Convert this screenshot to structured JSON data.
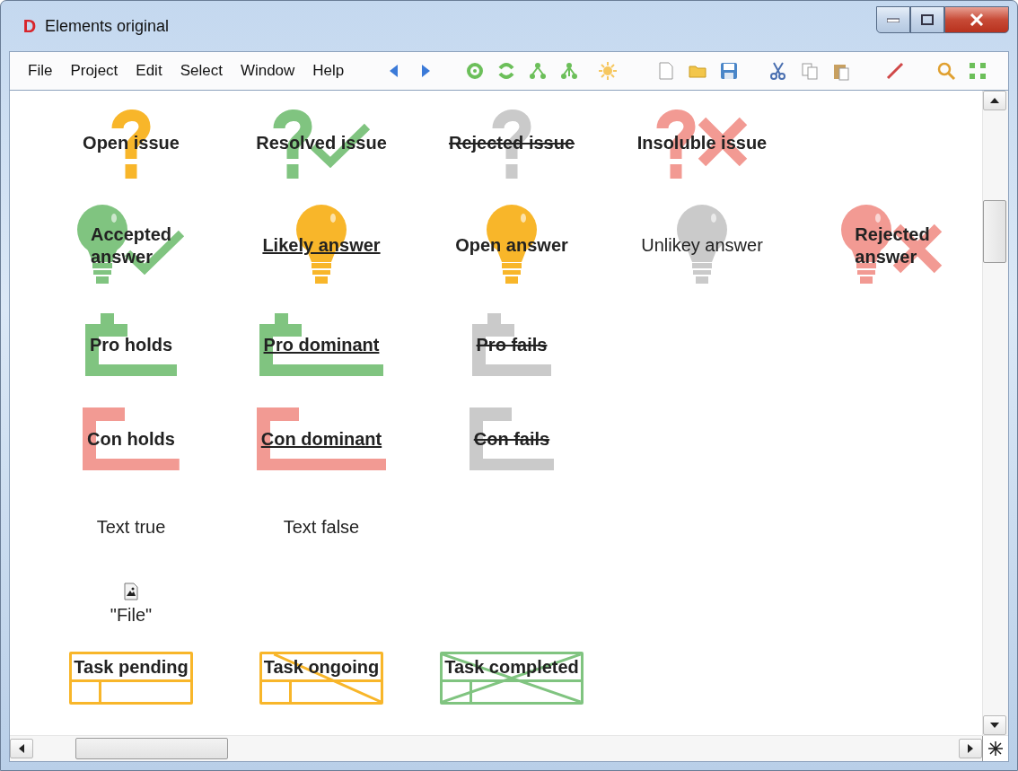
{
  "window": {
    "app_icon": "D",
    "title": "Elements original"
  },
  "menu": [
    "File",
    "Project",
    "Edit",
    "Select",
    "Window",
    "Help"
  ],
  "rows": [
    [
      {
        "kind": "question",
        "label": "Open issue",
        "color": "#f8b62a",
        "bold": true,
        "underlined": false,
        "struck": false,
        "checked": false,
        "crossed": false
      },
      {
        "kind": "question",
        "label": "Resolved issue",
        "color": "#80c480",
        "bold": true,
        "underlined": false,
        "struck": false,
        "checked": true,
        "crossed": false
      },
      {
        "kind": "question",
        "label": "Rejected issue",
        "color": "#cacaca",
        "bold": true,
        "underlined": false,
        "struck": true,
        "checked": false,
        "crossed": false
      },
      {
        "kind": "question",
        "label": "Insoluble issue",
        "color": "#f29a93",
        "bold": true,
        "underlined": false,
        "struck": false,
        "checked": false,
        "crossed": true
      }
    ],
    [
      {
        "kind": "bulb",
        "label": "Accepted answer",
        "color": "#80c480",
        "bold": true,
        "underlined": false,
        "struck": false,
        "checked": true,
        "crossed": false
      },
      {
        "kind": "bulb",
        "label": "Likely answer",
        "color": "#f8b62a",
        "bold": true,
        "underlined": true,
        "struck": false,
        "checked": false,
        "crossed": false
      },
      {
        "kind": "bulb",
        "label": "Open answer",
        "color": "#f8b62a",
        "bold": true,
        "underlined": false,
        "struck": false,
        "checked": false,
        "crossed": false
      },
      {
        "kind": "bulb",
        "label": "Unlikey answer",
        "color": "#cacaca",
        "bold": false,
        "underlined": false,
        "struck": false,
        "checked": false,
        "crossed": false
      },
      {
        "kind": "bulb",
        "label": "Rejected answer",
        "color": "#f29a93",
        "bold": true,
        "underlined": false,
        "struck": false,
        "checked": false,
        "crossed": true
      }
    ],
    [
      {
        "kind": "pro",
        "label": "Pro holds",
        "color": "#80c480",
        "bold": true,
        "underlined": false,
        "struck": false
      },
      {
        "kind": "pro",
        "label": "Pro dominant",
        "color": "#80c480",
        "bold": true,
        "underlined": true,
        "struck": false
      },
      {
        "kind": "pro",
        "label": "Pro fails",
        "color": "#cacaca",
        "bold": true,
        "underlined": false,
        "struck": true
      }
    ],
    [
      {
        "kind": "con",
        "label": "Con holds",
        "color": "#f29a93",
        "bold": true,
        "underlined": false,
        "struck": false
      },
      {
        "kind": "con",
        "label": "Con dominant",
        "color": "#f29a93",
        "bold": true,
        "underlined": true,
        "struck": false
      },
      {
        "kind": "con",
        "label": "Con fails",
        "color": "#cacaca",
        "bold": true,
        "underlined": false,
        "struck": true
      }
    ],
    [
      {
        "kind": "text",
        "label": "Text true",
        "bold": false,
        "underlined": false,
        "struck": false
      },
      {
        "kind": "text",
        "label": "Text false",
        "bold": false,
        "underlined": false,
        "struck": false
      }
    ],
    [
      {
        "kind": "file",
        "label": "\"File\"",
        "bold": false,
        "underlined": false,
        "struck": false
      }
    ],
    [
      {
        "kind": "task",
        "label": "Task pending",
        "color": "#f8b62a",
        "bold": true,
        "underlined": false,
        "struck": false,
        "half_crossed": false,
        "crossed": false
      },
      {
        "kind": "task",
        "label": "Task ongoing",
        "color": "#f8b62a",
        "bold": true,
        "underlined": false,
        "struck": false,
        "half_crossed": true,
        "crossed": false
      },
      {
        "kind": "task",
        "label": "Task completed",
        "color": "#80c480",
        "bold": true,
        "underlined": false,
        "struck": false,
        "half_crossed": false,
        "crossed": true
      }
    ]
  ]
}
